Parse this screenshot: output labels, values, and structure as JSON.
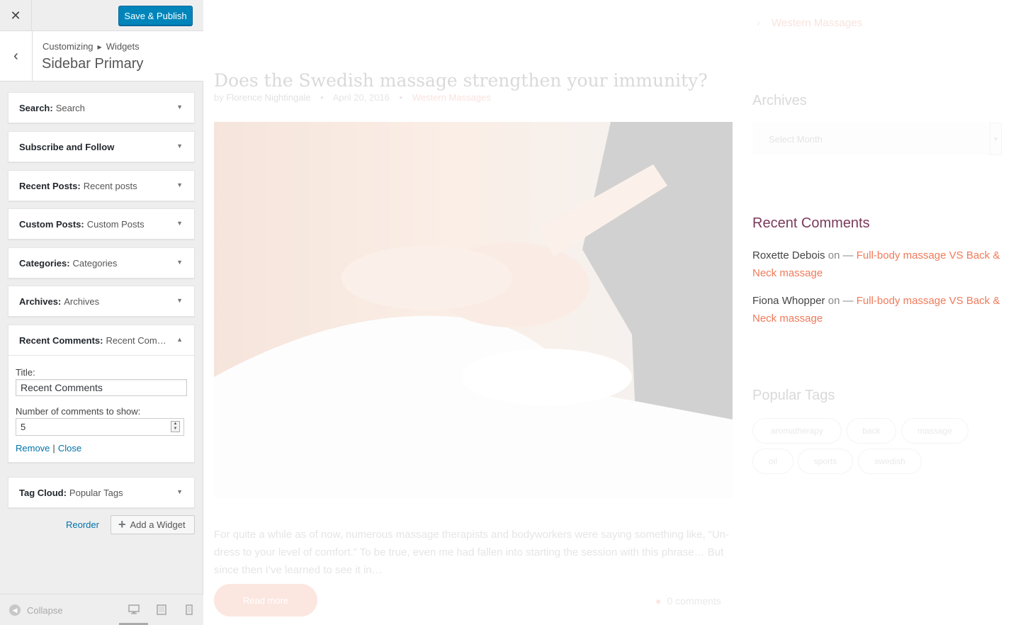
{
  "customizer": {
    "close_icon": "close-icon",
    "save_label": "Save & Publish",
    "breadcrumb": {
      "root": "Customizing",
      "section": "Widgets"
    },
    "section_title": "Sidebar Primary",
    "widgets": [
      {
        "type": "Search:",
        "name": "Search"
      },
      {
        "type": "Subscribe and Follow",
        "name": ""
      },
      {
        "type": "Recent Posts:",
        "name": "Recent posts"
      },
      {
        "type": "Custom Posts:",
        "name": "Custom Posts"
      },
      {
        "type": "Categories:",
        "name": "Categories"
      },
      {
        "type": "Archives:",
        "name": "Archives"
      },
      {
        "type": "Recent Comments:",
        "name": "Recent Com…"
      },
      {
        "type": "Tag Cloud:",
        "name": "Popular Tags"
      }
    ],
    "expanded_widget": {
      "title_label": "Title:",
      "title_value": "Recent Comments",
      "number_label": "Number of comments to show:",
      "number_value": "5",
      "remove_label": "Remove",
      "close_label": "Close",
      "separator": "|"
    },
    "reorder_label": "Reorder",
    "add_widget_label": "Add a Widget",
    "collapse_label": "Collapse",
    "devices": [
      "desktop-icon",
      "tablet-icon",
      "mobile-icon"
    ]
  },
  "preview": {
    "top_link": "Western Massages",
    "post": {
      "title": "Does the Swedish massage strengthen your immunity?",
      "by": "by",
      "author": "Florence Nightingale",
      "date": "April 20, 2016",
      "category": "Western Massages",
      "excerpt": "For quite a while as of now, numerous massage therapists and bodyworkers were saying something like, “Un-dress to your level of comfort.” To be true, even me had fallen into starting the session with this phrase… But since then I’ve learned to see it in…",
      "read_more": "Read more",
      "comments": "0 comments"
    },
    "archives": {
      "heading": "Archives",
      "select_placeholder": "Select Month"
    },
    "recent_comments": {
      "heading": "Recent Comments",
      "items": [
        {
          "author": "Roxette Debois",
          "on": "on —",
          "link": "Full-body massage VS Back & Neck massage"
        },
        {
          "author": "Fiona Whopper",
          "on": "on —",
          "link": "Full-body massage VS Back & Neck massage"
        }
      ]
    },
    "popular_tags": {
      "heading": "Popular Tags",
      "tags": [
        "aromatherapy",
        "back",
        "massage",
        "oil",
        "sports",
        "swedish"
      ]
    }
  },
  "colors": {
    "primary_button": "#0085ba",
    "link_blue": "#0073aa",
    "accent_salmon": "#f07a5a",
    "heading_plum": "#7a3a5a"
  }
}
